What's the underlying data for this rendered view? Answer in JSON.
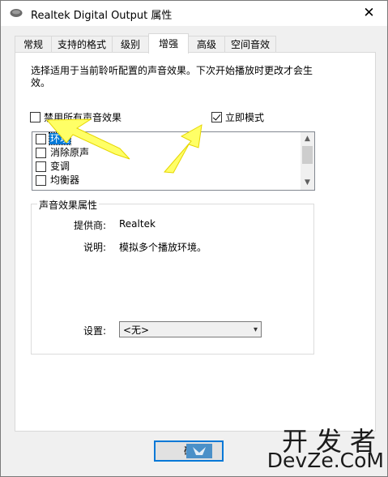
{
  "window": {
    "title": "Realtek Digital Output 属性",
    "close_glyph": "✕"
  },
  "tabs": [
    {
      "label": "常规"
    },
    {
      "label": "支持的格式"
    },
    {
      "label": "级别"
    },
    {
      "label": "增强"
    },
    {
      "label": "高级"
    },
    {
      "label": "空间音效"
    }
  ],
  "active_tab": "增强",
  "enhancements": {
    "description": "选择适用于当前聆听配置的声音效果。下次开始播放时更改才会生效。",
    "disable_all": {
      "label": "禁用所有声音效果",
      "checked": false
    },
    "immediate_mode": {
      "label": "立即模式",
      "checked": true
    },
    "effects": [
      {
        "label": "环境",
        "checked": false,
        "selected": true
      },
      {
        "label": "消除原声",
        "checked": false,
        "selected": false
      },
      {
        "label": "变调",
        "checked": false,
        "selected": false
      },
      {
        "label": "均衡器",
        "checked": false,
        "selected": false
      }
    ]
  },
  "properties": {
    "group_title": "声音效果属性",
    "provider_label": "提供商:",
    "provider_value": "Realtek",
    "description_label": "说明:",
    "description_value": "模拟多个播放环境。",
    "settings_label": "设置:",
    "settings_value": "<无>"
  },
  "footer": {
    "ok_label": "确"
  },
  "watermark": {
    "top": "开发者",
    "bottom": "DevZe.CoM"
  },
  "colors": {
    "selection": "#0078d7",
    "arrow": "#ffff66"
  }
}
